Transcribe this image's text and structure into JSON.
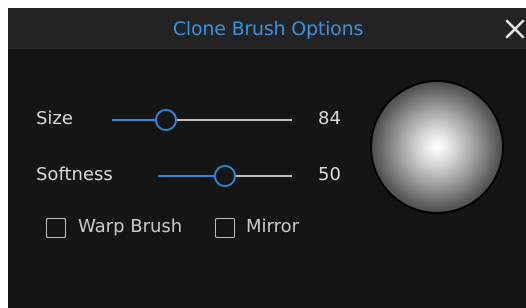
{
  "window": {
    "title": "Clone Brush Options",
    "close_icon": "close-icon"
  },
  "controls": {
    "size": {
      "label": "Size",
      "value": "84",
      "level": 0.3
    },
    "softness": {
      "label": "Softness",
      "value": "50",
      "level": 0.5
    }
  },
  "options": {
    "warp_brush": {
      "label": "Warp Brush",
      "checked": false
    },
    "mirror": {
      "label": "Mirror",
      "checked": false
    }
  },
  "colors": {
    "accent": "#2f86d9",
    "title": "#3a93e0",
    "background": "#151515",
    "titlebar": "#232323"
  }
}
